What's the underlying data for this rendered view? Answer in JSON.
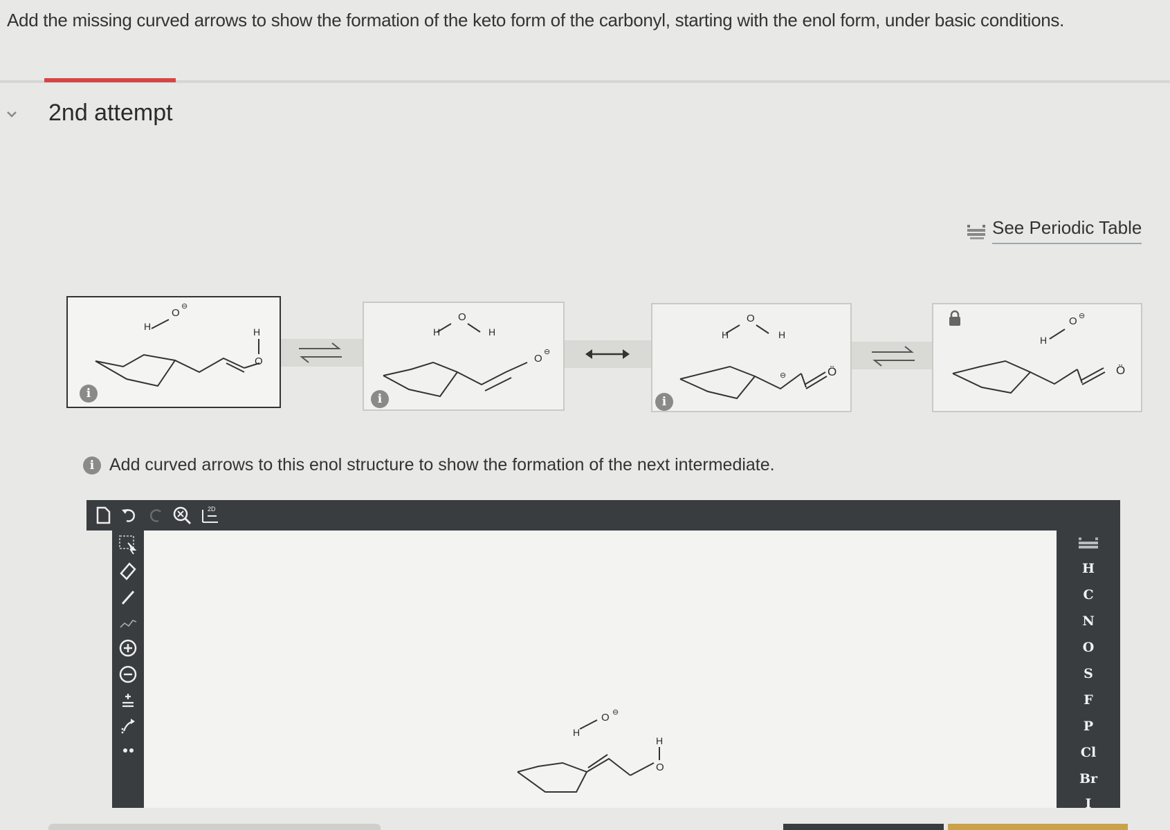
{
  "question": "Add the missing curved arrows to show the formation of the keto form of the carbonyl, starting with the enol form, under basic conditions.",
  "attempt_label": "2nd attempt",
  "periodic_table_link": "See Periodic Table",
  "instruction": "Add curved arrows to this enol structure to show the formation of the next intermediate.",
  "info_icon_text": "i",
  "atoms": {
    "H": "H",
    "O": "O",
    "O_dots": "Ö"
  },
  "editor_toolbar": {
    "button_2d": "2D"
  },
  "element_palette": [
    "H",
    "C",
    "N",
    "O",
    "S",
    "F",
    "P",
    "Cl",
    "Br",
    "I"
  ],
  "colors": {
    "accent_tab": "#d64545",
    "editor_bar": "#3a3d40",
    "panel_bg": "#f1f1ef",
    "gold_button": "#c9a24a"
  }
}
